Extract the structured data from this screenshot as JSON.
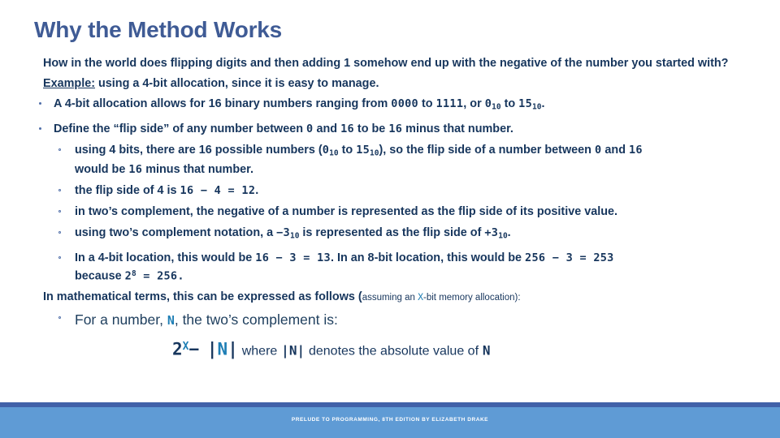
{
  "slide": {
    "title": "Why the Method Works",
    "intro": {
      "question": "How in the world does flipping digits and then adding 1 somehow end up with the negative of the number you started with?",
      "example_label": "Example:",
      "example_rest": " using a 4-bit allocation, since it is easy to manage."
    },
    "bullets": {
      "b1": {
        "pre": "A 4-bit allocation allows for 16 binary numbers ranging from ",
        "bin_low": "0000",
        "mid1": " to ",
        "bin_high": "1111",
        "mid2": ", or  ",
        "dec_low": "0",
        "dec_low_sub": "10",
        "mid3": "  to ",
        "dec_high": "15",
        "dec_high_sub": "10",
        "post": "."
      },
      "b2": {
        "pre": "Define the “flip side” of any number between ",
        "n0": "0",
        "mid1": " and  ",
        "n16": "16",
        "mid2": "  to be ",
        "n16b": "16",
        "post": " minus that number."
      },
      "s1": {
        "pre": "using 4 bits, there are 16 possible numbers (",
        "v0": "0",
        "v0_sub": "10",
        "mid1": " to ",
        "v15": "15",
        "v15_sub": "10",
        "mid2": "), so the flip side of a number between ",
        "n0": "0",
        "mid3": " and ",
        "n16": "16",
        "line2_pre": "would be ",
        "line2_num": "16",
        "line2_post": " minus that number."
      },
      "s2": {
        "pre": "the flip side of 4 is ",
        "expr": "16  −  4  =  12",
        "post": "."
      },
      "s3": {
        "text": "in two’s complement, the negative of a number is represented as the flip side of its positive value."
      },
      "s4": {
        "pre": "using two’s complement notation, a ",
        "neg3": "−3",
        "neg3_sub": "10",
        "mid": "  is represented as the flip side of ",
        "pos3": "+3",
        "pos3_sub": "10",
        "post": "."
      },
      "s5": {
        "pre": "In a 4-bit location, this would be ",
        "expr1": "16  −  3  =  13",
        "mid": ". In an 8-bit location, this would be ",
        "expr2": "256  −  3  =  253",
        "line2_pre": "because ",
        "base": "2",
        "exp": "8",
        "line2_post": "  =  256."
      }
    },
    "math_intro": {
      "pre": "In mathematical terms, this can be expressed as follows (",
      "note_pre": "assuming an ",
      "var_x": "X",
      "note_post": "-bit memory allocation):"
    },
    "definition": {
      "pre": "For a number, ",
      "var_n": "N",
      "post": ", the two’s complement is:"
    },
    "formula": {
      "base": "2",
      "exponent": "X",
      "minus": "−",
      "abs_open": "|",
      "var_n": "N",
      "abs_close": "|",
      "where": "where",
      "abs2_open": "|",
      "var_n2": "N",
      "abs2_close": "|",
      "denotes": "denotes the absolute value of",
      "var_n3": "N"
    },
    "footer": {
      "text": "PRELUDE TO PROGRAMMING, 8TH EDITION BY ELIZABETH DRAKE"
    },
    "colors": {
      "title": "#3f5b95",
      "body": "#17365d",
      "accent": "#1f7fb5",
      "footer_band": "#5f9bd5",
      "footer_stripe": "#4161a8"
    }
  }
}
